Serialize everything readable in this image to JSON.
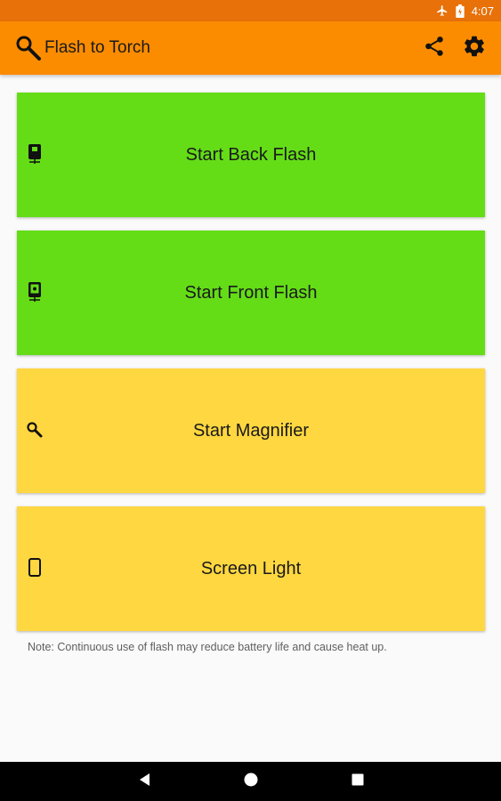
{
  "status_bar": {
    "time": "4:07",
    "icons": [
      "airplane-mode-icon",
      "battery-icon"
    ]
  },
  "app_bar": {
    "title": "Flash to Torch",
    "logo_icon": "magnifier-icon",
    "actions": [
      "share-icon",
      "settings-icon"
    ]
  },
  "cards": [
    {
      "label": "Start Back Flash",
      "icon": "phone-back-flash-icon",
      "color": "#64dd17"
    },
    {
      "label": "Start Front Flash",
      "icon": "phone-front-flash-icon",
      "color": "#64dd17"
    },
    {
      "label": "Start Magnifier",
      "icon": "magnifier-icon",
      "color": "#ffd740"
    },
    {
      "label": "Screen Light",
      "icon": "phone-screen-icon",
      "color": "#ffd740"
    }
  ],
  "note": "Note: Continuous use of flash may reduce battery life and cause heat up.",
  "nav_bar": {
    "buttons": [
      "back-icon",
      "home-icon",
      "recents-icon"
    ]
  },
  "colors": {
    "status_bar": "#e8710a",
    "app_bar": "#fb8c00",
    "background": "#fafafa",
    "green_card": "#64dd17",
    "yellow_card": "#ffd740"
  }
}
